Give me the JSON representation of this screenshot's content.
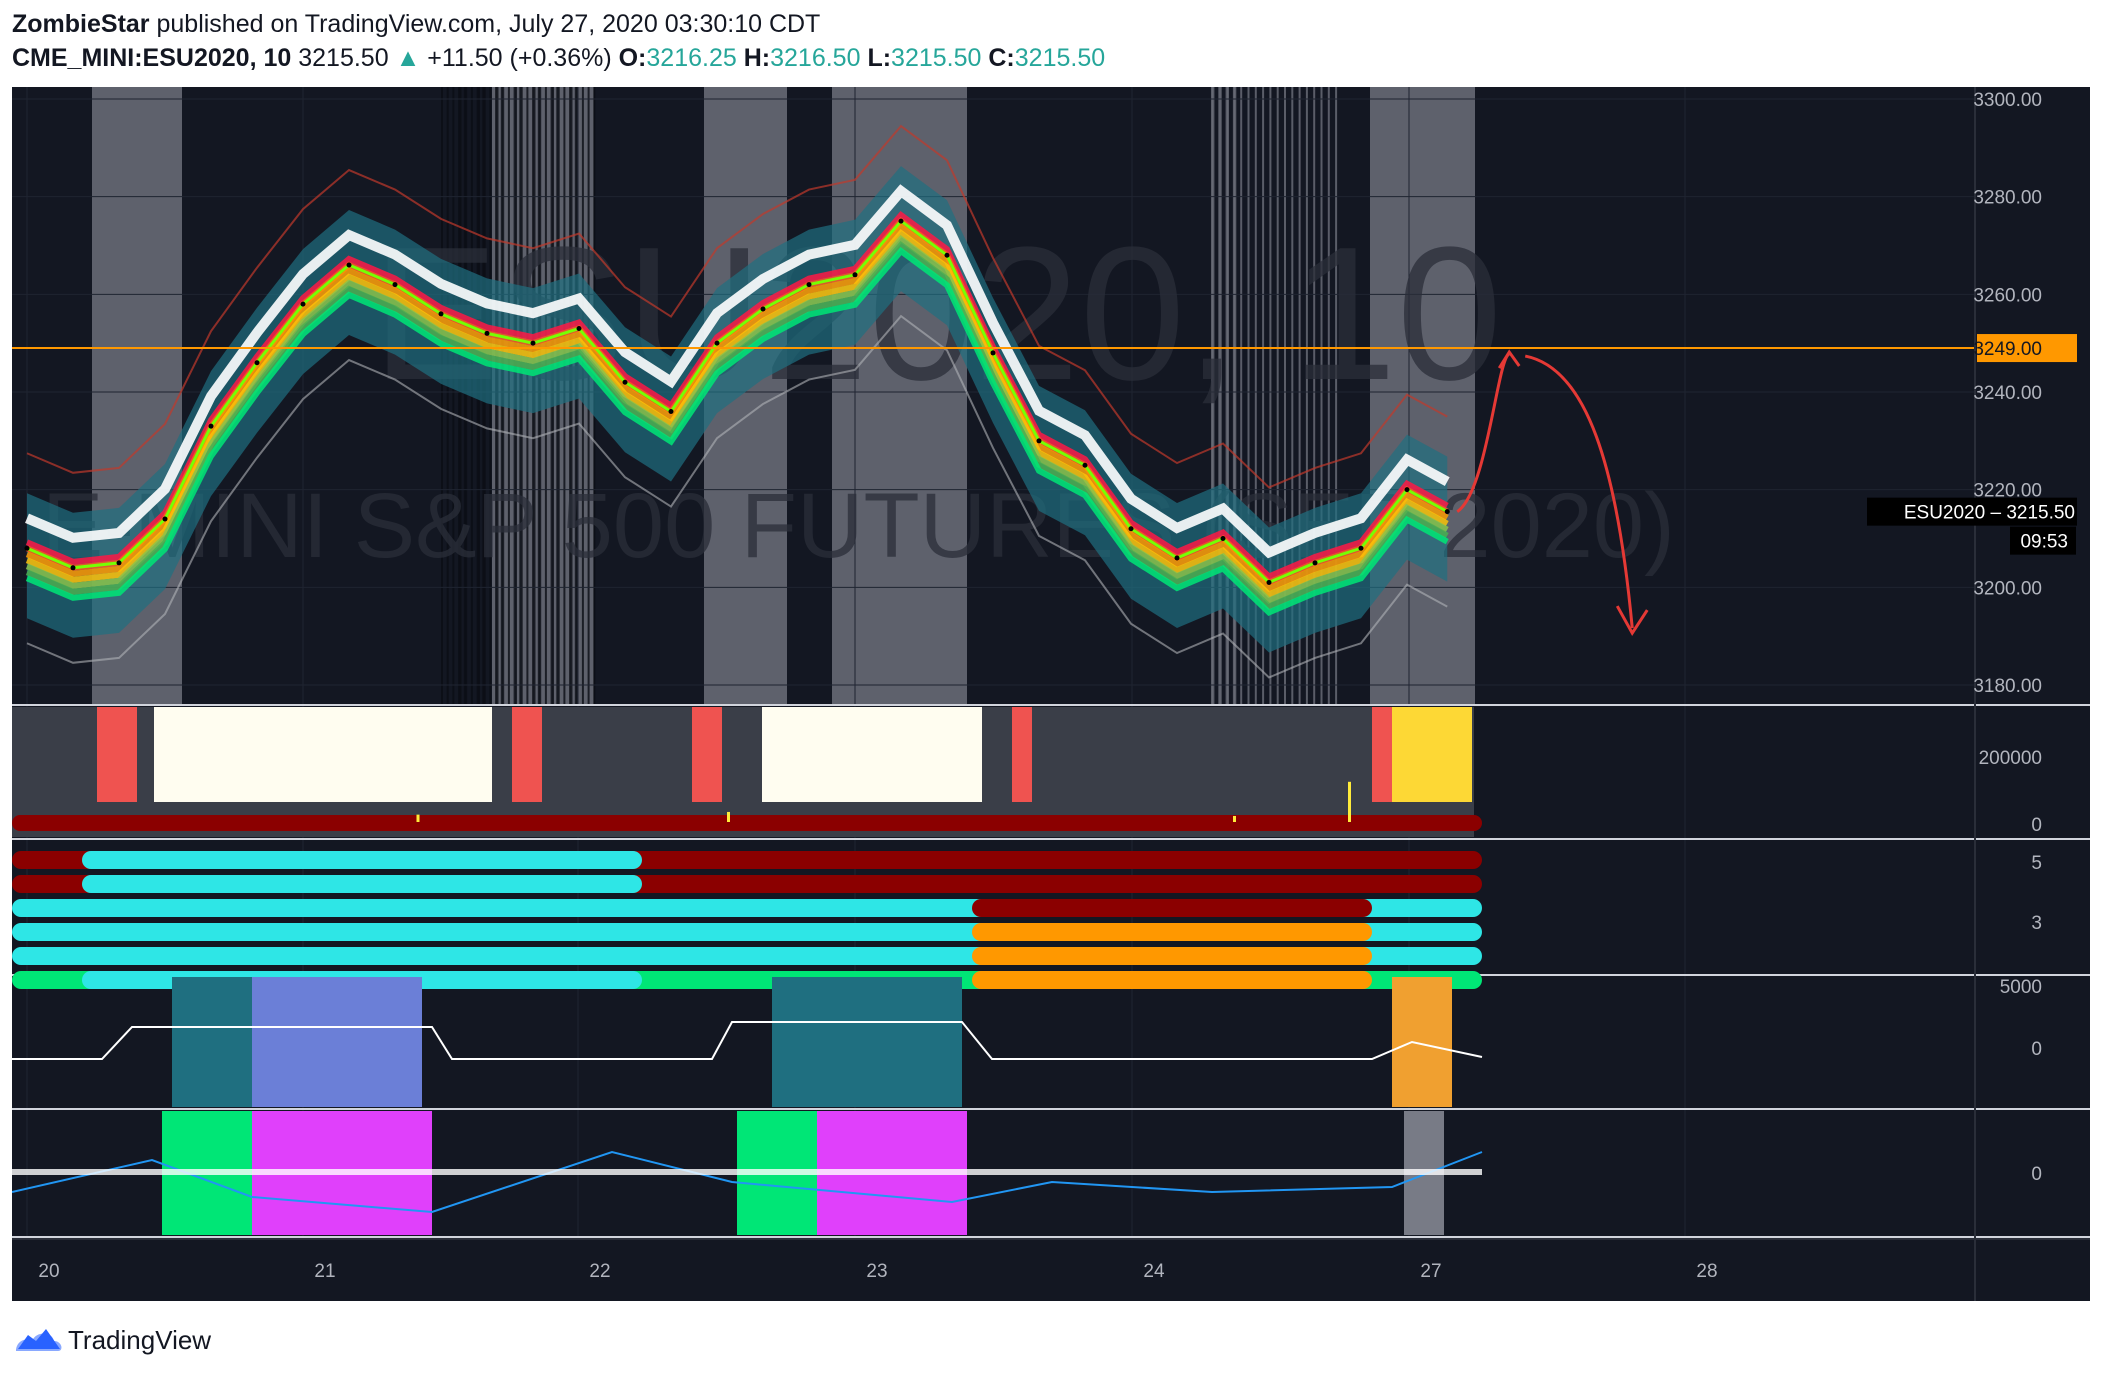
{
  "header": {
    "author": "ZombieStar",
    "published_text": "published on TradingView.com, July 27, 2020 03:30:10 CDT",
    "symbol": "CME_MINI:ESU2020, 10",
    "last": "3215.50",
    "change_arrow": "▲",
    "change": "+11.50 (+0.36%)",
    "o_label": "O:",
    "o_value": "3216.25",
    "h_label": "H:",
    "h_value": "3216.50",
    "l_label": "L:",
    "l_value": "3215.50",
    "c_label": "C:",
    "c_value": "3215.50"
  },
  "watermark": {
    "symbol_text": "ESU2020, 10",
    "description_text": "E-MINI S&P 500 FUTURES (SEP 2020)"
  },
  "footer": {
    "brand": "TradingView",
    "logo_icon": "tradingview-logo-icon"
  },
  "colors": {
    "background": "#131722",
    "up": "#26a69a",
    "horizontal_line": "#ff9800",
    "annotation_arrow": "#e53935",
    "session_shade": "#787b86"
  },
  "chart_data": {
    "type": "line",
    "title": "CME_MINI:ESU2020, 10",
    "x_tick_labels": [
      "20",
      "21",
      "22",
      "23",
      "24",
      "27",
      "28"
    ],
    "ylim": [
      3175,
      3305
    ],
    "y_tick_labels": [
      "3300.00",
      "3280.00",
      "3260.00",
      "3240.00",
      "3220.00",
      "3200.00",
      "3180.00"
    ],
    "y_ticks": [
      3300,
      3280,
      3260,
      3240,
      3220,
      3200,
      3180
    ],
    "horizontal_level": {
      "value": 3249.0,
      "label": "3249.00"
    },
    "last_price_label": {
      "symbol": "ESU2020",
      "value": "3215.50",
      "countdown": "09:53"
    },
    "series": [
      {
        "type": "line",
        "x": [
          "2020-07-20 00:00",
          "2020-07-20 04:00",
          "2020-07-20 08:00",
          "2020-07-20 12:00",
          "2020-07-20 16:00",
          "2020-07-20 20:00",
          "2020-07-21 00:00",
          "2020-07-21 04:00",
          "2020-07-21 08:00",
          "2020-07-21 12:00",
          "2020-07-21 16:00",
          "2020-07-21 20:00",
          "2020-07-22 00:00",
          "2020-07-22 04:00",
          "2020-07-22 08:00",
          "2020-07-22 12:00",
          "2020-07-22 16:00",
          "2020-07-22 20:00",
          "2020-07-23 00:00",
          "2020-07-23 04:00",
          "2020-07-23 08:00",
          "2020-07-23 12:00",
          "2020-07-23 16:00",
          "2020-07-23 20:00",
          "2020-07-24 00:00",
          "2020-07-24 04:00",
          "2020-07-24 08:00",
          "2020-07-24 12:00",
          "2020-07-24 16:00",
          "2020-07-24 20:00",
          "2020-07-27 00:00",
          "2020-07-27 03:30"
        ],
        "y": [
          3208,
          3204,
          3205,
          3214,
          3233,
          3246,
          3258,
          3266,
          3262,
          3256,
          3252,
          3250,
          3253,
          3242,
          3236,
          3250,
          3257,
          3262,
          3264,
          3275,
          3268,
          3248,
          3230,
          3225,
          3212,
          3206,
          3210,
          3201,
          3205,
          3208,
          3220,
          3215.5
        ]
      }
    ],
    "volume_pane": {
      "y_tick_labels": [
        "200000",
        "0"
      ],
      "y_ticks": [
        200000,
        0
      ],
      "spikes": [
        {
          "x": "2020-07-21 10:00",
          "value": 22000
        },
        {
          "x": "2020-07-22 13:00",
          "value": 30000
        },
        {
          "x": "2020-07-24 09:00",
          "value": 18000
        },
        {
          "x": "2020-07-24 19:00",
          "value": 120000
        }
      ]
    },
    "dots_pane": {
      "y_tick_labels": [
        "5",
        "3"
      ],
      "y_ticks": [
        5,
        3
      ],
      "rows": 6
    },
    "oscillator_pane": {
      "y_tick_labels": [
        "5000",
        "0"
      ],
      "y_ticks": [
        5000,
        0
      ]
    },
    "bottom_pane": {
      "y_tick_labels": [
        "0"
      ],
      "y_ticks": [
        0
      ]
    }
  }
}
